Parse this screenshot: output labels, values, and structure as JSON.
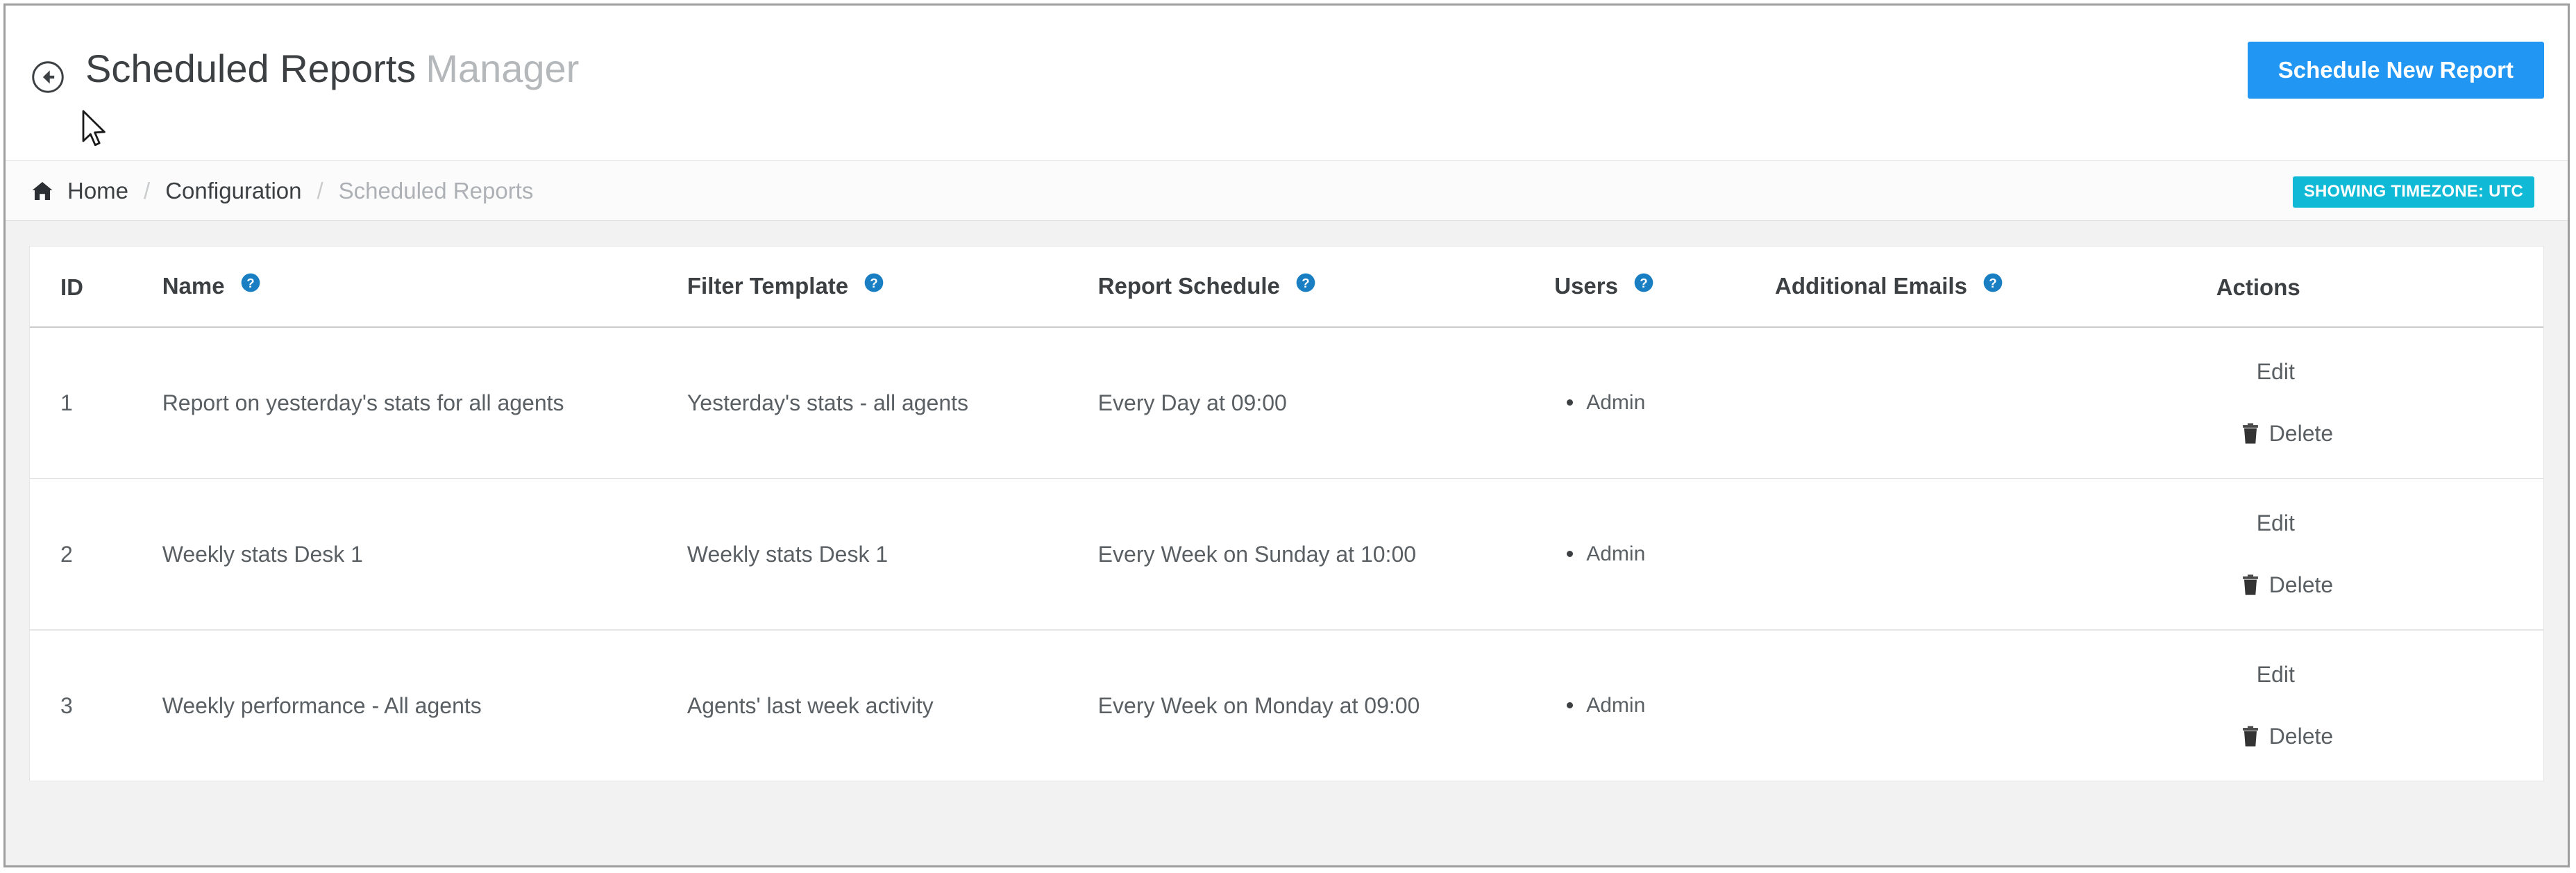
{
  "header": {
    "back_icon": "arrow-left-circle-icon",
    "title_main": "Scheduled Reports",
    "title_sub": "Manager",
    "schedule_button": "Schedule New Report"
  },
  "breadcrumb": {
    "home_icon": "home-icon",
    "items": [
      {
        "label": "Home",
        "current": false
      },
      {
        "label": "Configuration",
        "current": false
      },
      {
        "label": "Scheduled Reports",
        "current": true
      }
    ],
    "separator": "/",
    "timezone_badge": "SHOWING TIMEZONE: UTC",
    "timezone_badge_color": "#10b9d6"
  },
  "table": {
    "columns": [
      {
        "label": "ID",
        "help": false
      },
      {
        "label": "Name",
        "help": true
      },
      {
        "label": "Filter Template",
        "help": true
      },
      {
        "label": "Report Schedule",
        "help": true
      },
      {
        "label": "Users",
        "help": true
      },
      {
        "label": "Additional Emails",
        "help": true
      },
      {
        "label": "Actions",
        "help": false
      }
    ],
    "help_icon": "question-circle-icon",
    "help_icon_color": "#1a7ec2",
    "rows": [
      {
        "id": "1",
        "name": "Report on yesterday's stats for all agents",
        "filter_template": "Yesterday's stats - all agents",
        "report_schedule": "Every Day at 09:00",
        "users": [
          "Admin"
        ],
        "additional_emails": "",
        "edit_label": "Edit",
        "delete_label": "Delete",
        "delete_icon": "trash-icon"
      },
      {
        "id": "2",
        "name": "Weekly stats Desk 1",
        "filter_template": "Weekly stats Desk 1",
        "report_schedule": "Every Week on Sunday at 10:00",
        "users": [
          "Admin"
        ],
        "additional_emails": "",
        "edit_label": "Edit",
        "delete_label": "Delete",
        "delete_icon": "trash-icon"
      },
      {
        "id": "3",
        "name": "Weekly performance - All agents",
        "filter_template": "Agents' last week activity",
        "report_schedule": "Every Week on Monday at 09:00",
        "users": [
          "Admin"
        ],
        "additional_emails": "",
        "edit_label": "Edit",
        "delete_label": "Delete",
        "delete_icon": "trash-icon"
      }
    ]
  },
  "colors": {
    "accent_blue": "#2196f3",
    "badge_cyan": "#10b9d6",
    "page_bg": "#f2f2f2",
    "text": "#3c4043",
    "muted_text": "#b5b8bb"
  },
  "cursor": {
    "icon": "mouse-pointer-icon"
  }
}
